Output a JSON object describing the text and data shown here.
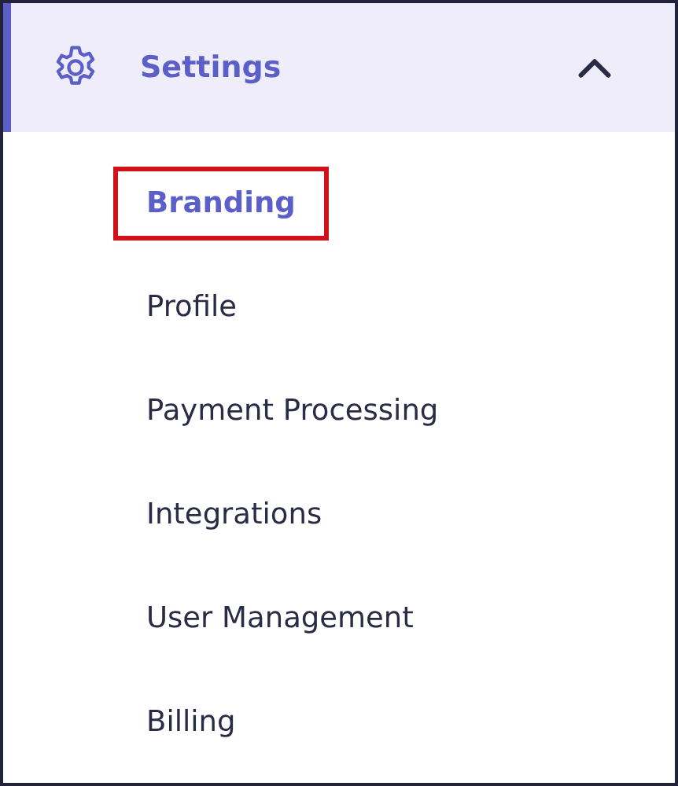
{
  "section": {
    "title": "Settings",
    "expanded": true,
    "active": true,
    "items": [
      {
        "label": "Branding",
        "selected": true,
        "highlighted": true
      },
      {
        "label": "Profile",
        "selected": false,
        "highlighted": false
      },
      {
        "label": "Payment Processing",
        "selected": false,
        "highlighted": false
      },
      {
        "label": "Integrations",
        "selected": false,
        "highlighted": false
      },
      {
        "label": "User Management",
        "selected": false,
        "highlighted": false
      },
      {
        "label": "Billing",
        "selected": false,
        "highlighted": false
      }
    ]
  }
}
